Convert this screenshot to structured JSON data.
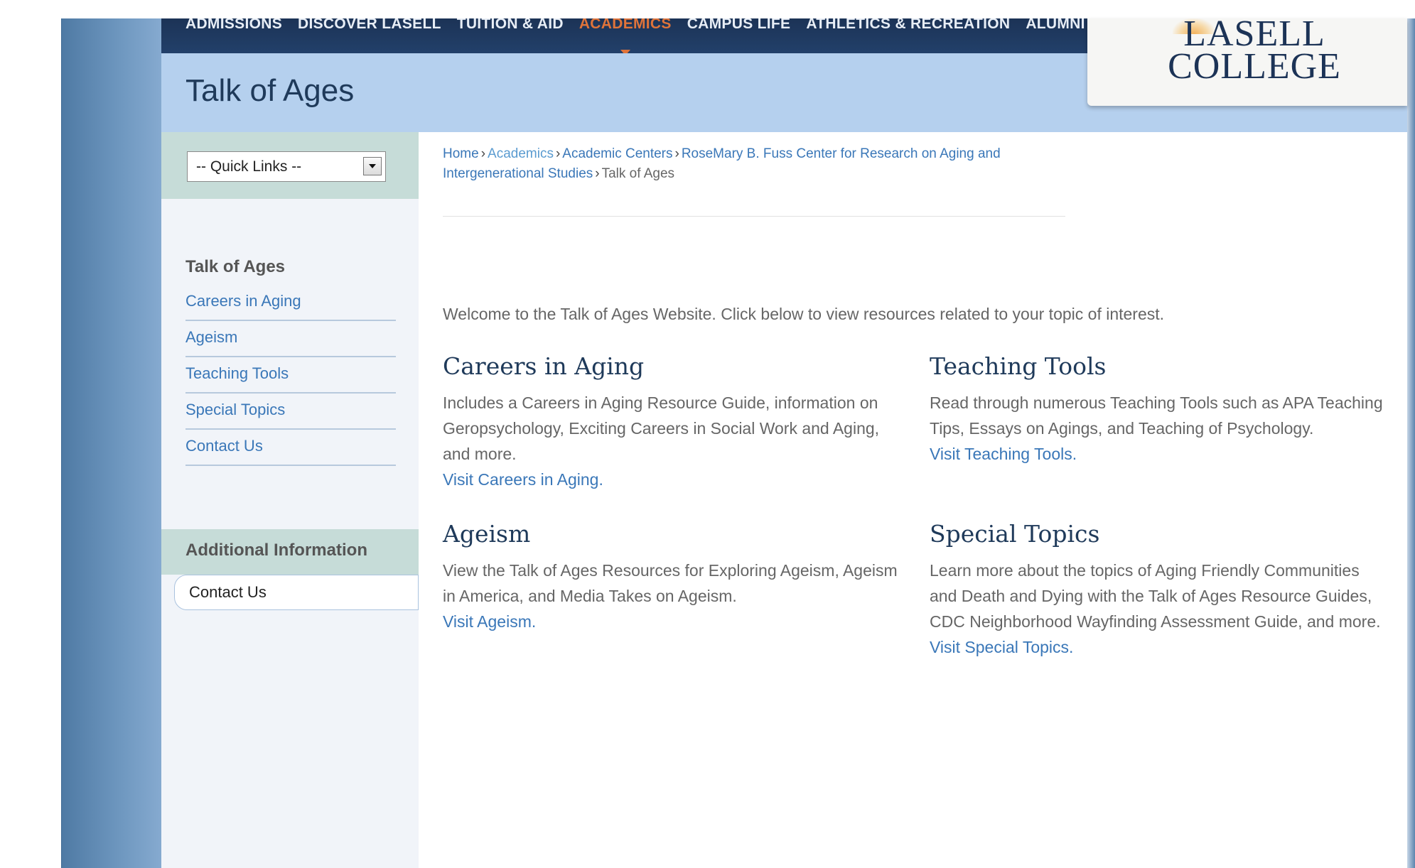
{
  "nav": {
    "items": [
      "Admissions",
      "Discover Lasell",
      "Tuition & Aid",
      "Academics",
      "Campus Life",
      "Athletics & Recreation",
      "Alumni & Friends"
    ],
    "active": "Academics"
  },
  "header": {
    "title": "Talk of Ages"
  },
  "logo": {
    "line1": "LASELL",
    "line2": "COLLEGE"
  },
  "sidebar": {
    "quick_links": "-- Quick Links --",
    "heading": "Talk of Ages",
    "items": [
      "Careers in Aging",
      "Ageism",
      "Teaching Tools",
      "Special Topics",
      "Contact Us"
    ],
    "additional_heading": "Additional Information",
    "additional_item": "Contact Us"
  },
  "breadcrumb": {
    "items": [
      "Home",
      "Academics",
      "Academic Centers",
      "RoseMary B. Fuss Center for Research on Aging and Intergenerational Studies"
    ],
    "current": "Talk of Ages"
  },
  "main": {
    "welcome": "Welcome to the Talk of Ages Website. Click below to view resources related to your topic of interest.",
    "blocks": {
      "careers": {
        "title": "Careers in Aging",
        "body": "Includes a Careers in Aging Resource Guide, information on Geropsychology, Exciting Careers in Social Work and Aging, and more.",
        "link": "Visit Careers in Aging."
      },
      "teaching": {
        "title": "Teaching Tools",
        "body": "Read through numerous Teaching Tools such as APA Teaching Tips, Essays on Agings, and Teaching of Psychology.",
        "link": "Visit Teaching Tools."
      },
      "ageism": {
        "title": "Ageism",
        "body": "View the Talk of Ages Resources for Exploring Ageism, Ageism in America, and Media Takes on Ageism.",
        "link": "Visit Ageism."
      },
      "special": {
        "title": "Special Topics",
        "body": "Learn more about the topics of Aging Friendly Communities and Death and Dying with the Talk of Ages Resource Guides, CDC Neighborhood Wayfinding Assessment Guide, and more.",
        "link": "Visit Special Topics."
      }
    }
  },
  "colors": {
    "nav_bg": "#1c3356",
    "nav_active": "#e0743a",
    "header_band": "#b5d0ee",
    "link": "#3a77b8",
    "heading": "#1f3a5a"
  }
}
